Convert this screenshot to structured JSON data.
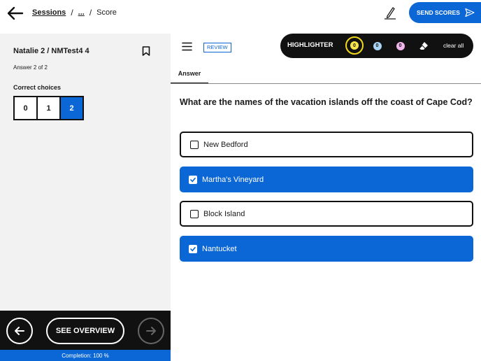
{
  "header": {
    "breadcrumb": {
      "sessions": "Sessions",
      "sep": "/",
      "ellipsis": "...",
      "current": "Score"
    },
    "send_scores_label": "SEND SCORES",
    "icons": {
      "back": "back-arrow-icon",
      "pen": "pen-icon",
      "send": "send-icon"
    }
  },
  "sidebar": {
    "student_title": "Natalie 2 / NMTest4 4",
    "answer_count": "Answer 2 of 2",
    "choices_label": "Correct choices",
    "choices": [
      {
        "label": "0",
        "selected": false
      },
      {
        "label": "1",
        "selected": false
      },
      {
        "label": "2",
        "selected": true
      }
    ],
    "overview_label": "SEE OVERVIEW",
    "completion": "Completion: 100 %"
  },
  "toolbar": {
    "review_tag": "REVIEW",
    "highlighter_label": "HIGHLIGHTER",
    "highlights": [
      {
        "count": "0",
        "color": "#f7e64a"
      },
      {
        "count": "0",
        "color": "#a9d4f5"
      },
      {
        "count": "0",
        "color": "#f3b6ec"
      }
    ],
    "clear_all": "clear all"
  },
  "main": {
    "tab_answer": "Answer",
    "question": "What are the names of the vacation islands off the coast of Cape Cod?",
    "options": [
      {
        "label": "New Bedford",
        "checked": false
      },
      {
        "label": "Martha's Vineyard",
        "checked": true
      },
      {
        "label": "Block Island",
        "checked": false
      },
      {
        "label": "Nantucket",
        "checked": true
      }
    ]
  },
  "colors": {
    "accent": "#0b66d6",
    "dark": "#111111",
    "panel": "#f2f2f2"
  }
}
